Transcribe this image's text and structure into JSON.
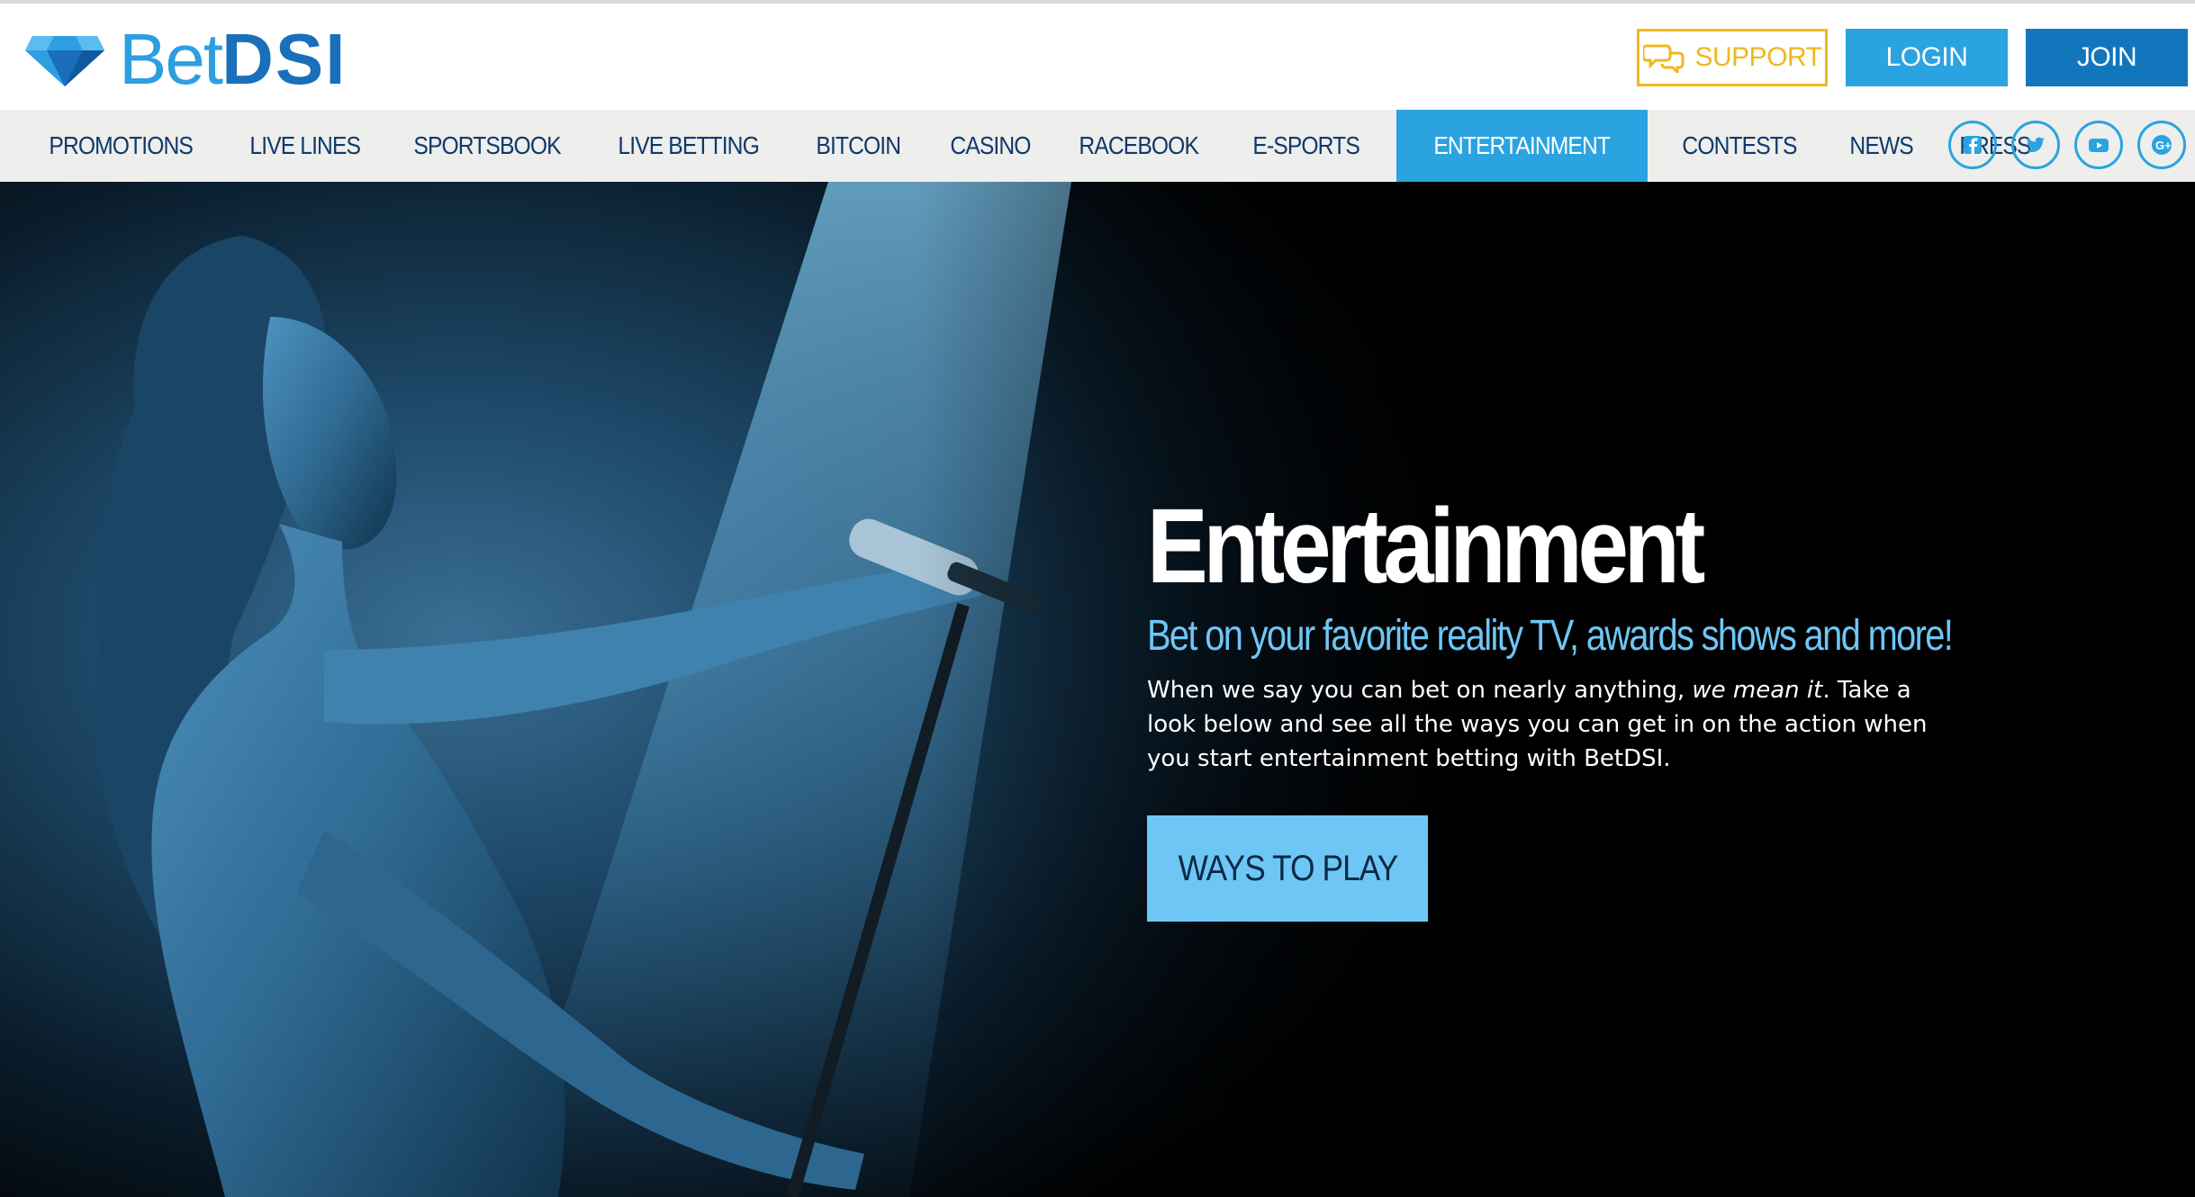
{
  "brand": {
    "name_part1": "Bet",
    "name_part2": "DSI",
    "primary_color": "#2d9fe0",
    "dark_color": "#1a6fba"
  },
  "header": {
    "support_label": "SUPPORT",
    "login_label": "LOGIN",
    "join_label": "JOIN",
    "support_icon": "chat-bubbles-icon"
  },
  "nav": {
    "items": [
      {
        "label": "PROMOTIONS"
      },
      {
        "label": "LIVE LINES"
      },
      {
        "label": "SPORTSBOOK"
      },
      {
        "label": "LIVE BETTING"
      },
      {
        "label": "BITCOIN"
      },
      {
        "label": "CASINO"
      },
      {
        "label": "RACEBOOK"
      },
      {
        "label": "E-SPORTS"
      },
      {
        "label": "ENTERTAINMENT",
        "active": true
      },
      {
        "label": "CONTESTS"
      },
      {
        "label": "NEWS"
      },
      {
        "label": "PRESS"
      }
    ],
    "active_color": "#2aa3e0",
    "socials": [
      "facebook-icon",
      "twitter-icon",
      "youtube-icon",
      "google-plus-icon"
    ]
  },
  "hero": {
    "title": "Entertainment",
    "subtitle": "Bet on your favorite reality TV, awards shows and more!",
    "body_pre": "When we say you can bet on nearly anything, ",
    "body_em": "we mean it",
    "body_post": ". Take a look below and see all the ways you can get in on the action when you start entertainment betting with BetDSI.",
    "cta_label": "WAYS TO PLAY",
    "cta_color": "#6ec6f5"
  }
}
